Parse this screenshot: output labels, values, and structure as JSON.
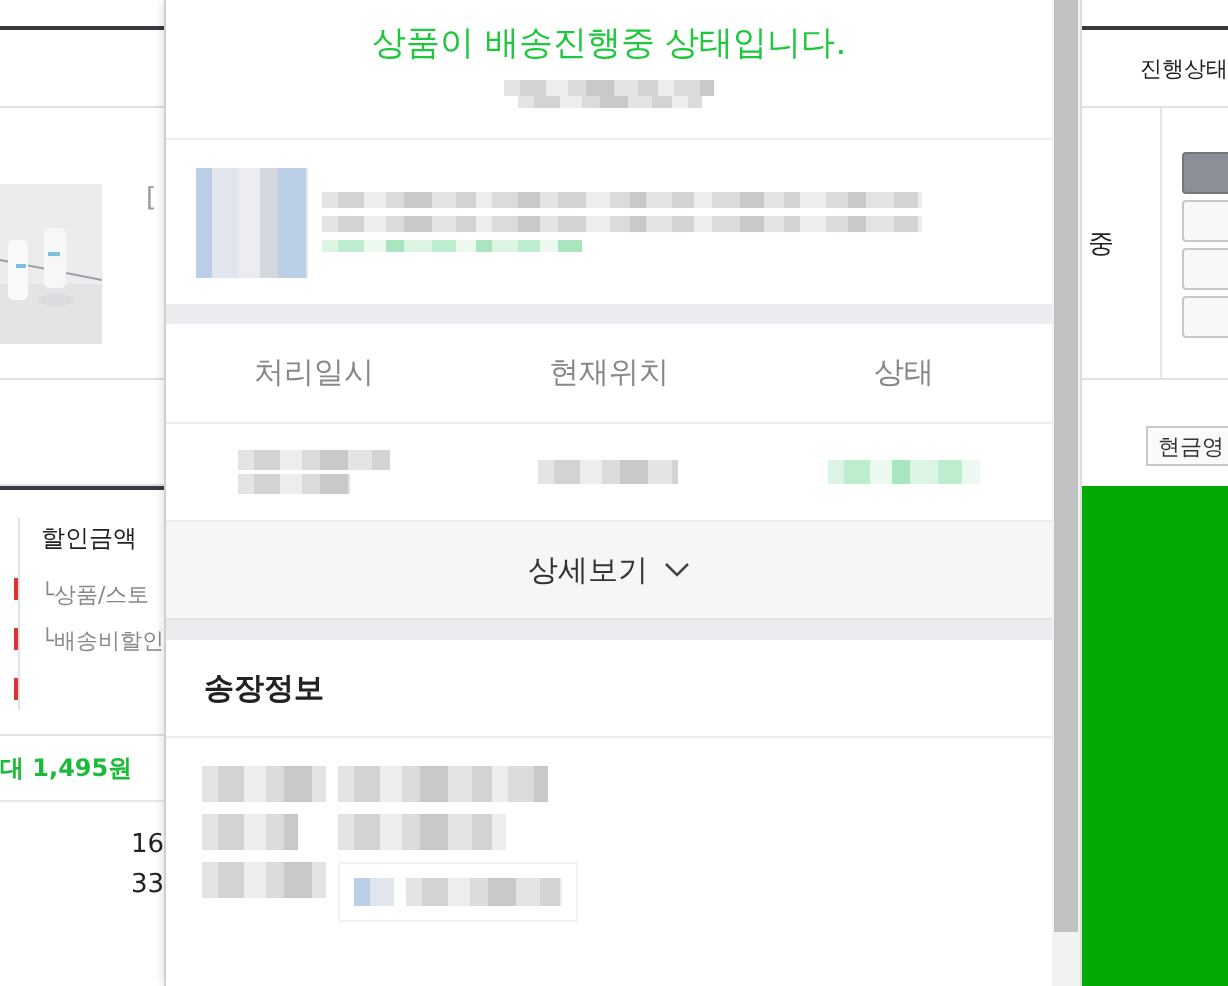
{
  "background_page": {
    "left": {
      "product_lines": [
        "["
      ],
      "discount_label": "할인금액",
      "discount_items": [
        "└상품/스토",
        "└배송비할인"
      ],
      "points_note": "대 1,495원",
      "amounts": [
        "16",
        "33"
      ]
    },
    "right": {
      "status_header": "진행상태",
      "status_value": "중",
      "receipt_button": "현금영"
    }
  },
  "dialog": {
    "title": "상품이 배송진행중 상태입니다.",
    "tracking_table": {
      "columns": [
        "처리일시",
        "현재위치",
        "상태"
      ]
    },
    "details_button": {
      "label": "상세보기",
      "expanded": false
    },
    "invoice_section": {
      "title": "송장정보"
    }
  }
}
